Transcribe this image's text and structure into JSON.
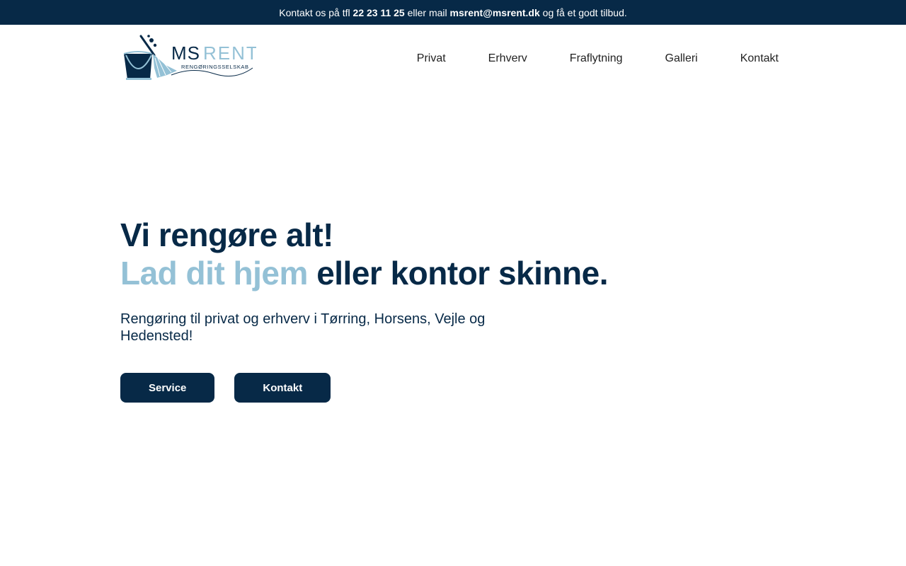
{
  "topbar": {
    "text_1": "Kontakt os på tfl",
    "phone": "22 23 11 25",
    "text_2": "eller mail",
    "email": "msrent@msrent.dk",
    "text_3": "og få et godt tilbud."
  },
  "logo": {
    "brand_dark": "MS",
    "brand_light": "RENT",
    "tagline": "RENGØRINGSSELSKAB",
    "icon": "bucket-mop-logo"
  },
  "nav": {
    "items": [
      {
        "label": "Privat"
      },
      {
        "label": "Erhverv"
      },
      {
        "label": "Fraflytning"
      },
      {
        "label": "Galleri"
      },
      {
        "label": "Kontakt"
      }
    ]
  },
  "hero": {
    "title_line1": "Vi rengøre alt!",
    "title_line2_highlight": "Lad dit hjem",
    "title_line2_rest": "eller kontor skinne.",
    "subtitle": "Rengøring til privat og erhverv i Tørring, Horsens, Vejle og Hedensted!",
    "buttons": [
      {
        "label": "Service"
      },
      {
        "label": "Kontakt"
      }
    ]
  },
  "colors": {
    "primary": "#072947",
    "accent": "#94c1d6",
    "background": "#ffffff"
  }
}
